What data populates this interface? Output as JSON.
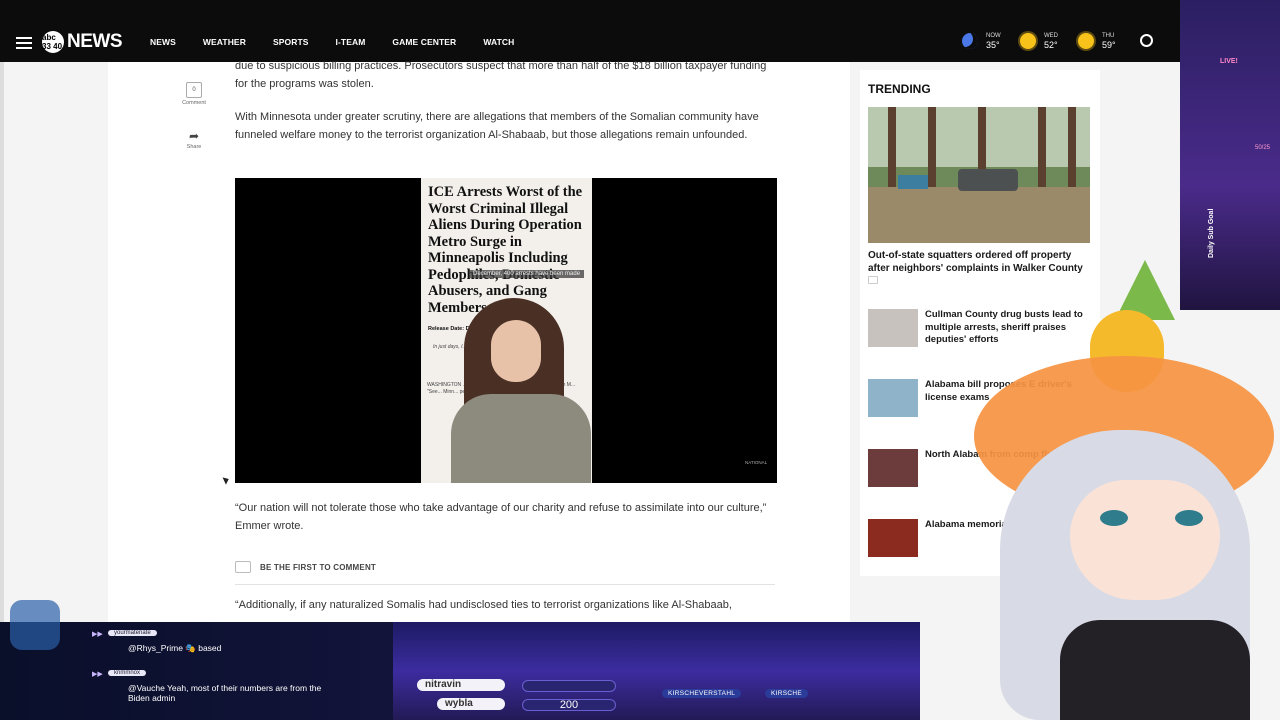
{
  "header": {
    "logo_badge": "abc 33 40",
    "logo_text": "NEWS",
    "nav": [
      "NEWS",
      "WEATHER",
      "SPORTS",
      "I-TEAM",
      "GAME CENTER",
      "WATCH"
    ],
    "weather": [
      {
        "day": "NOW",
        "temp": "35°",
        "icon": "moon-icon"
      },
      {
        "day": "WED",
        "temp": "52°",
        "icon": "sun-icon"
      },
      {
        "day": "THU",
        "temp": "59°",
        "icon": "sun-icon"
      }
    ]
  },
  "share": {
    "comment_count": "0",
    "comment_label": "Comment",
    "share_label": "Share"
  },
  "article": {
    "p1": "due to suspicious billing practices. Prosecutors suspect that more than half of the $18 billion taxpayer funding for the programs was stolen.",
    "p2": "With Minnesota under greater scrutiny, there are allegations that members of the Somalian community have funneled welfare money to the terrorist organization Al-Shabaab, but those allegations remain unfounded.",
    "video": {
      "headline": "ICE Arrests Worst of the Worst Criminal Illegal Aliens During Operation Metro Surge in Minneapolis Including Pedophiles, Domestic Abusers, and Gang Members",
      "caption_note": "December, 400 arrests have been made",
      "release": "Release Date: D",
      "italic": "In just days, I... minals who were allowed... thanks to",
      "body": "WASHINGTON ... Customs Enforce... some... inclu... viole... in M... \"See... Minn... pedo",
      "watermark": "NATIONAL"
    },
    "p3": "“Our nation will not tolerate those who take advantage of our charity and refuse to assimilate into our culture,” Emmer wrote.",
    "comment_cta": "BE THE FIRST TO COMMENT",
    "p4": "“Additionally, if any naturalized Somalis had undisclosed ties to terrorist organizations like Al-Shabaab,"
  },
  "trending": {
    "title": "TRENDING",
    "lead": "Out-of-state squatters ordered off property after neighbors' complaints in Walker County",
    "items": [
      "Cullman County drug busts lead to multiple arrests, sheriff praises deputies' efforts",
      "Alabama bill proposes E driver's license exams",
      "North Alabam from comp flu",
      "Alabama memorial s claimed"
    ]
  },
  "overlay": {
    "live": "LIVE!",
    "goal_label": "Daily Sub Goal",
    "goal_count": "50/25",
    "chat": [
      {
        "user": "yourmatenate",
        "msg": "@Rhys_Prime 🎭 based"
      },
      {
        "user": "krimmnox",
        "msg": "@Vauche Yeah, most of their numbers are from the Biden admin"
      }
    ],
    "bars": [
      {
        "name": "nitravin",
        "value": ""
      },
      {
        "name": "wybla",
        "value": "200"
      }
    ],
    "socials": [
      "KIRSCHEVERSTAHL",
      "KIRSCHE"
    ]
  }
}
